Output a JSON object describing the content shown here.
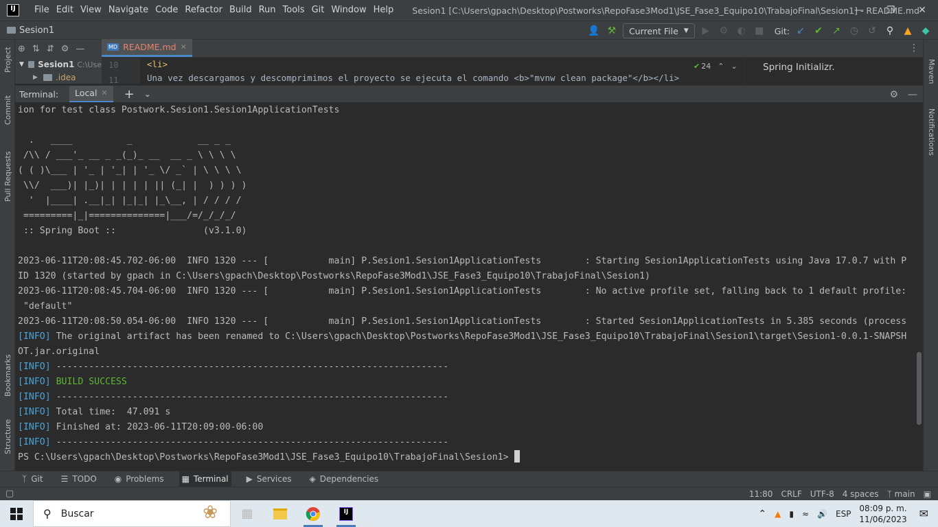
{
  "app": {
    "logo": "IJ",
    "window_title": "Sesion1 [C:\\Users\\gpach\\Desktop\\Postworks\\RepoFase3Mod1\\JSE_Fase3_Equipo10\\TrabajoFinal\\Sesion1] - README.md",
    "menu": [
      "File",
      "Edit",
      "View",
      "Navigate",
      "Code",
      "Refactor",
      "Build",
      "Run",
      "Tools",
      "Git",
      "Window",
      "Help"
    ]
  },
  "navbar": {
    "project": "Sesion1",
    "run_config": "Current File",
    "git_label": "Git:"
  },
  "left_stripe": {
    "project": "Project",
    "commit": "Commit",
    "pull_requests": "Pull Requests",
    "bookmarks": "Bookmarks",
    "structure": "Structure"
  },
  "right_stripe": {
    "maven": "Maven",
    "notifications": "Notifications"
  },
  "project_panel": {
    "root_name": "Sesion1",
    "root_path": "C:\\Use",
    "child": ".idea"
  },
  "editor": {
    "tab": "README.md",
    "tab_badge": "MD",
    "lines": [
      {
        "no": "10",
        "text": "<li>"
      },
      {
        "no": "11",
        "text": "Una vez descargamos y descomprimimos el proyecto se ejecuta el comando <b>\"mvnw clean package\"</b></li>"
      }
    ],
    "warnings": "24",
    "preview_text": "Spring Initializr."
  },
  "terminal": {
    "title": "Terminal:",
    "tab": "Local",
    "lines": [
      "ion for test class Postwork.Sesion1.Sesion1ApplicationTests",
      "",
      "  .   ____          _            __ _ _",
      " /\\\\ / ___'_ __ _ _(_)_ __  __ _ \\ \\ \\ \\",
      "( ( )\\___ | '_ | '_| | '_ \\/ _` | \\ \\ \\ \\",
      " \\\\/  ___)| |_)| | | | | || (_| |  ) ) ) )",
      "  '  |____| .__|_| |_|_| |_\\__, | / / / /",
      " =========|_|==============|___/=/_/_/_/",
      " :: Spring Boot ::                (v3.1.0)",
      "",
      "2023-06-11T20:08:45.702-06:00  INFO 1320 --- [           main] P.Sesion1.Sesion1ApplicationTests        : Starting Sesion1ApplicationTests using Java 17.0.7 with P",
      "ID 1320 (started by gpach in C:\\Users\\gpach\\Desktop\\Postworks\\RepoFase3Mod1\\JSE_Fase3_Equipo10\\TrabajoFinal\\Sesion1)",
      "2023-06-11T20:08:45.704-06:00  INFO 1320 --- [           main] P.Sesion1.Sesion1ApplicationTests        : No active profile set, falling back to 1 default profile:",
      " \"default\"",
      "2023-06-11T20:08:50.054-06:00  INFO 1320 --- [           main] P.Sesion1.Sesion1ApplicationTests        : Started Sesion1ApplicationTests in 5.385 seconds (process"
    ],
    "info_lines": [
      {
        "tag": "[INFO]",
        "text": " The original artifact has been renamed to C:\\Users\\gpach\\Desktop\\Postworks\\RepoFase3Mod1\\JSE_Fase3_Equipo10\\TrabajoFinal\\Sesion1\\target\\Sesion1-0.0.1-SNAPSH"
      },
      {
        "tag": "",
        "text": "OT.jar.original"
      },
      {
        "tag": "[INFO]",
        "text": " ------------------------------------------------------------------------"
      },
      {
        "tag": "[INFO]",
        "text": " ",
        "success": "BUILD SUCCESS"
      },
      {
        "tag": "[INFO]",
        "text": " ------------------------------------------------------------------------"
      },
      {
        "tag": "[INFO]",
        "text": " Total time:  47.091 s"
      },
      {
        "tag": "[INFO]",
        "text": " Finished at: 2023-06-11T20:09:00-06:00"
      },
      {
        "tag": "[INFO]",
        "text": " ------------------------------------------------------------------------"
      }
    ],
    "prompt": "PS C:\\Users\\gpach\\Desktop\\Postworks\\RepoFase3Mod1\\JSE_Fase3_Equipo10\\TrabajoFinal\\Sesion1> "
  },
  "tool_tabs": [
    "Git",
    "TODO",
    "Problems",
    "Terminal",
    "Services",
    "Dependencies"
  ],
  "status": {
    "position": "11:80",
    "line_sep": "CRLF",
    "encoding": "UTF-8",
    "indent": "4 spaces",
    "branch": "main"
  },
  "taskbar": {
    "search_placeholder": "Buscar",
    "lang": "ESP",
    "time": "08:09 p. m.",
    "date": "11/06/2023"
  },
  "colors": {
    "accent": "#4a88c7",
    "info": "#4aa5d9",
    "success": "#5fb636",
    "tab_modified": "#e8826c"
  }
}
